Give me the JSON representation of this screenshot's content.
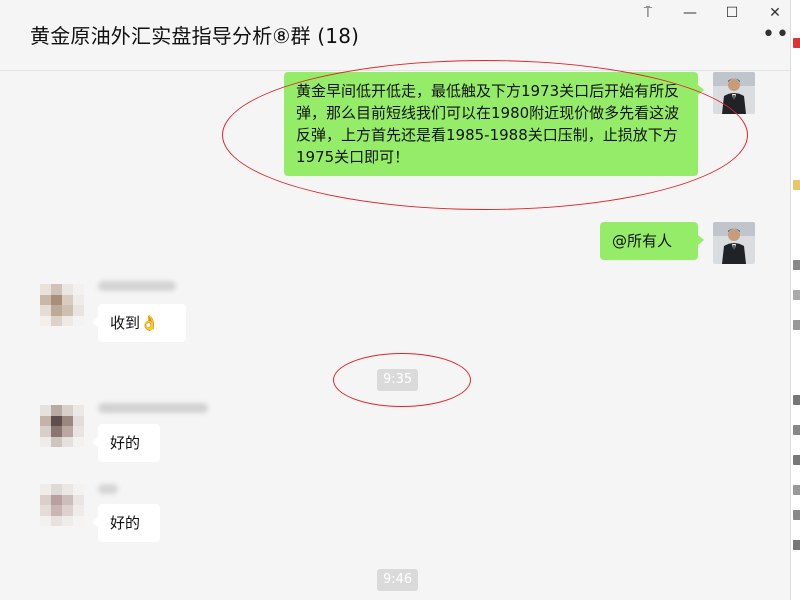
{
  "header": {
    "title": "黄金原油外汇实盘指导分析⑧群 (18)",
    "more_label": "•••"
  },
  "window_controls": {
    "pin": "⍑",
    "minimize": "—",
    "maximize": "☐",
    "close": "✕"
  },
  "messages": [
    {
      "sender": "self",
      "text": "黄金早间低开低走，最低触及下方1973关口后开始有所反弹，那么目前短线我们可以在1980附近现价做多先看这波反弹，上方首先还是看1985-1988关口压制，止损放下方1975关口即可！"
    },
    {
      "sender": "self",
      "text": "@所有人"
    },
    {
      "sender": "other",
      "text": "收到",
      "emoji": "👌"
    },
    {
      "sender": "other",
      "text": "好的"
    },
    {
      "sender": "other",
      "text": "好的"
    }
  ],
  "timestamps": [
    "9:35",
    "9:46"
  ],
  "colors": {
    "self_bubble": "#95ec69",
    "other_bubble": "#ffffff",
    "annotation": "#e0242a",
    "background": "#f5f5f5"
  }
}
